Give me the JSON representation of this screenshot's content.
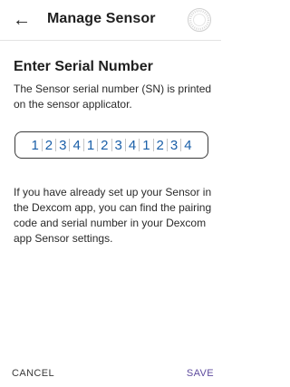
{
  "header": {
    "back_icon": "arrow-left-icon",
    "title": "Manage Sensor",
    "sensor_icon": "sensor-dial-icon"
  },
  "main": {
    "heading": "Enter Serial Number",
    "description": "The Sensor serial number (SN) is printed on the sensor applicator.",
    "serial_digits": [
      "1",
      "2",
      "3",
      "4",
      "1",
      "2",
      "3",
      "4",
      "1",
      "2",
      "3",
      "4"
    ],
    "info": "If you have already set up your Sensor in the Dexcom app, you can find the pairing code and serial number in your Dexcom app Sensor settings."
  },
  "footer": {
    "cancel_label": "CANCEL",
    "save_label": "SAVE"
  },
  "colors": {
    "accent": "#5e4b9e",
    "digits": "#1a5fa8"
  }
}
